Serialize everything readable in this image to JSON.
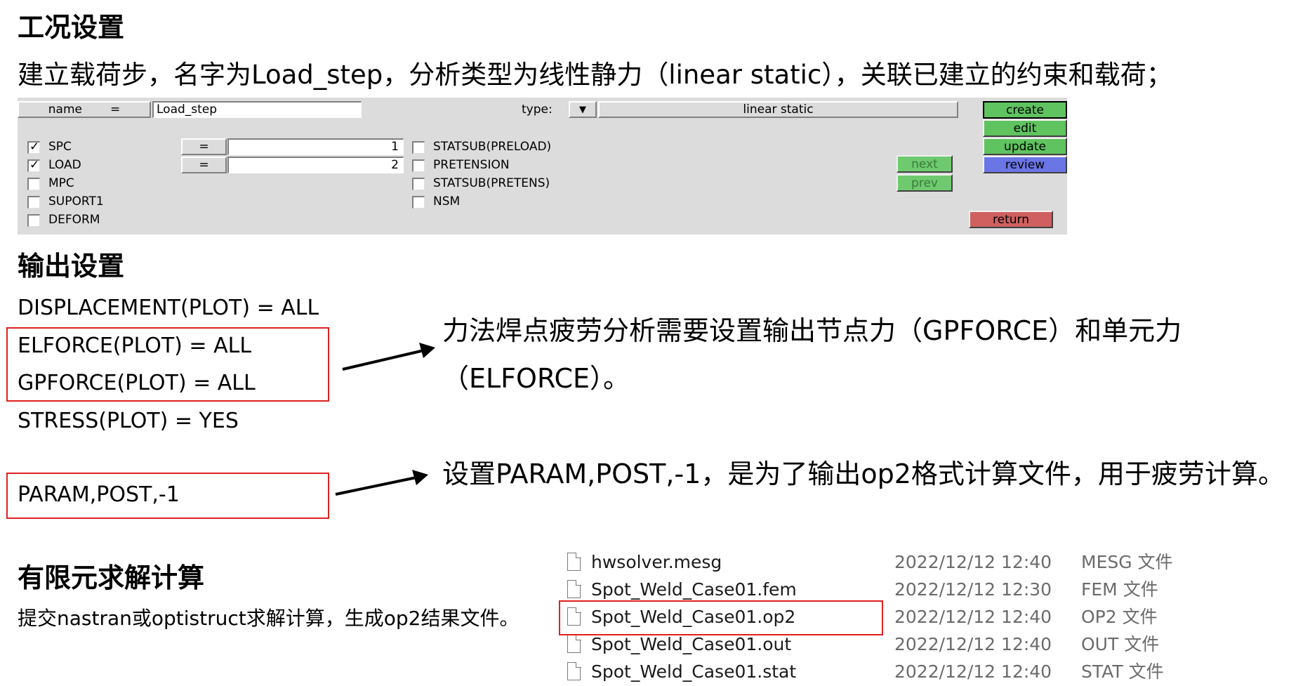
{
  "section1": {
    "heading": "工况设置",
    "description": "建立载荷步，名字为Load_step，分析类型为线性静力（linear static），关联已建立的约束和载荷；"
  },
  "panel": {
    "name_label": "name",
    "name_eq": "=",
    "name_value": "Load_step",
    "type_label": "type:",
    "type_value": "linear static",
    "checkboxes_left": [
      {
        "label": "SPC",
        "checked": true
      },
      {
        "label": "LOAD",
        "checked": true
      },
      {
        "label": "MPC",
        "checked": false
      },
      {
        "label": "SUPORT1",
        "checked": false
      },
      {
        "label": "DEFORM",
        "checked": false
      }
    ],
    "spc_eq": "=",
    "spc_value": "1",
    "load_eq": "=",
    "load_value": "2",
    "checkboxes_right": [
      {
        "label": "STATSUB(PRELOAD)",
        "checked": false
      },
      {
        "label": "PRETENSION",
        "checked": false
      },
      {
        "label": "STATSUB(PRETENS)",
        "checked": false
      },
      {
        "label": "NSM",
        "checked": false
      }
    ],
    "buttons": {
      "next": "next",
      "prev": "prev",
      "create": "create",
      "edit": "edit",
      "update": "update",
      "review": "review",
      "return": "return"
    }
  },
  "section2": {
    "heading": "输出设置",
    "lines": [
      "DISPLACEMENT(PLOT) = ALL",
      "ELFORCE(PLOT) = ALL",
      "GPFORCE(PLOT) = ALL",
      "STRESS(PLOT) = YES"
    ],
    "param_line": "PARAM,POST,-1",
    "note1_line1": "力法焊点疲劳分析需要设置输出节点力（GPFORCE）和单元力",
    "note1_line2": "（ELFORCE）。",
    "note2": "设置PARAM,POST,-1，是为了输出op2格式计算文件，用于疲劳计算。"
  },
  "section3": {
    "heading": "有限元求解计算",
    "description": "提交nastran或optistruct求解计算，生成op2结果文件。"
  },
  "files": [
    {
      "name": "hwsolver.mesg",
      "date": "2022/12/12 12:40",
      "type": "MESG 文件"
    },
    {
      "name": "Spot_Weld_Case01.fem",
      "date": "2022/12/12 12:30",
      "type": "FEM 文件"
    },
    {
      "name": "Spot_Weld_Case01.op2",
      "date": "2022/12/12 12:40",
      "type": "OP2 文件"
    },
    {
      "name": "Spot_Weld_Case01.out",
      "date": "2022/12/12 12:40",
      "type": "OUT 文件"
    },
    {
      "name": "Spot_Weld_Case01.stat",
      "date": "2022/12/12 12:40",
      "type": "STAT 文件"
    }
  ],
  "colors": {
    "highlight_red": "#e0201f",
    "button_green": "#5fc35f",
    "button_blue": "#6a75e6",
    "button_red": "#d06060",
    "panel_gray": "#dcdcdc"
  }
}
